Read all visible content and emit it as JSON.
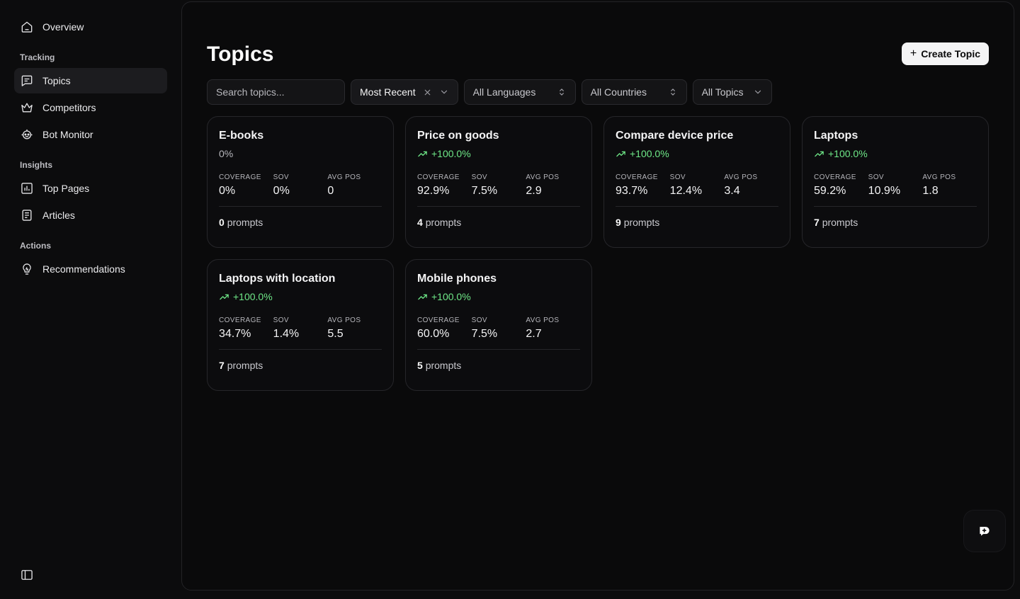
{
  "sidebar": {
    "overview": "Overview",
    "sections": {
      "tracking": "Tracking",
      "insights": "Insights",
      "actions": "Actions"
    },
    "items": {
      "topics": "Topics",
      "competitors": "Competitors",
      "bot_monitor": "Bot Monitor",
      "top_pages": "Top Pages",
      "articles": "Articles",
      "recommendations": "Recommendations"
    }
  },
  "header": {
    "title": "Topics",
    "create_label": "Create Topic"
  },
  "filters": {
    "search_placeholder": "Search topics...",
    "sort": "Most Recent",
    "languages": "All Languages",
    "countries": "All Countries",
    "topics": "All Topics"
  },
  "metric_labels": {
    "coverage": "COVERAGE",
    "sov": "SOV",
    "avg_pos": "AVG POS",
    "prompts_suffix": "prompts"
  },
  "cards": [
    {
      "title": "E-books",
      "trend": "0%",
      "trend_dir": "flat",
      "coverage": "0%",
      "sov": "0%",
      "avg_pos": "0",
      "prompts": "0"
    },
    {
      "title": "Price on goods",
      "trend": "+100.0%",
      "trend_dir": "up",
      "coverage": "92.9%",
      "sov": "7.5%",
      "avg_pos": "2.9",
      "prompts": "4"
    },
    {
      "title": "Compare device price",
      "trend": "+100.0%",
      "trend_dir": "up",
      "coverage": "93.7%",
      "sov": "12.4%",
      "avg_pos": "3.4",
      "prompts": "9"
    },
    {
      "title": "Laptops",
      "trend": "+100.0%",
      "trend_dir": "up",
      "coverage": "59.2%",
      "sov": "10.9%",
      "avg_pos": "1.8",
      "prompts": "7"
    },
    {
      "title": "Laptops with location",
      "trend": "+100.0%",
      "trend_dir": "up",
      "coverage": "34.7%",
      "sov": "1.4%",
      "avg_pos": "5.5",
      "prompts": "7"
    },
    {
      "title": "Mobile phones",
      "trend": "+100.0%",
      "trend_dir": "up",
      "coverage": "60.0%",
      "sov": "7.5%",
      "avg_pos": "2.7",
      "prompts": "5"
    }
  ],
  "colors": {
    "trend_up": "#6ee787",
    "background": "#0c0c0d"
  }
}
